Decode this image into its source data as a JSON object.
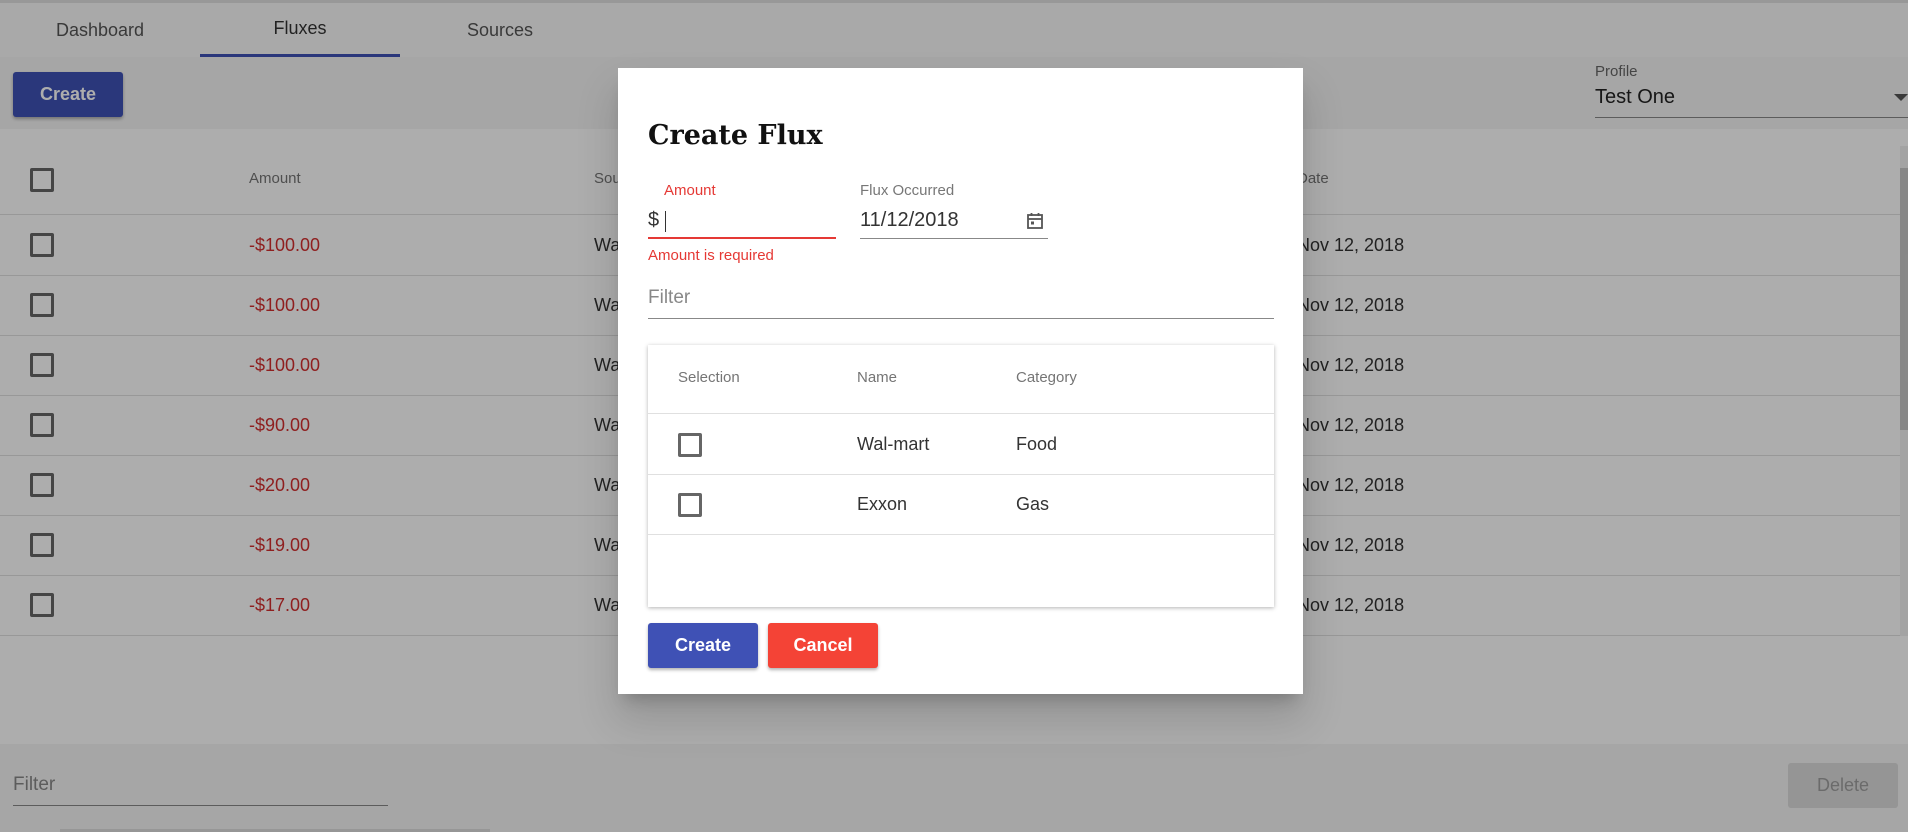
{
  "tabs": [
    {
      "label": "Dashboard",
      "active": false
    },
    {
      "label": "Fluxes",
      "active": true
    },
    {
      "label": "Sources",
      "active": false
    }
  ],
  "toolbar": {
    "create_label": "Create",
    "profile_label": "Profile",
    "profile_value": "Test One"
  },
  "table": {
    "columns": [
      "Amount",
      "Sou",
      "Date"
    ],
    "rows": [
      {
        "amount": "-$100.00",
        "source": "Wa",
        "date": "Nov 12, 2018"
      },
      {
        "amount": "-$100.00",
        "source": "Wa",
        "date": "Nov 12, 2018"
      },
      {
        "amount": "-$100.00",
        "source": "Wa",
        "date": "Nov 12, 2018"
      },
      {
        "amount": "-$90.00",
        "source": "Wa",
        "date": "Nov 12, 2018"
      },
      {
        "amount": "-$20.00",
        "source": "Wa",
        "date": "Nov 12, 2018"
      },
      {
        "amount": "-$19.00",
        "source": "Wa",
        "date": "Nov 12, 2018"
      },
      {
        "amount": "-$17.00",
        "source": "Wa",
        "date": "Nov 12, 2018"
      }
    ]
  },
  "footer": {
    "filter_placeholder": "Filter",
    "delete_label": "Delete"
  },
  "dialog": {
    "title": "Create Flux",
    "amount_label": "Amount",
    "amount_prefix": "$",
    "amount_value": "",
    "amount_error": "Amount is required",
    "date_label": "Flux Occurred",
    "date_value": "11/12/2018",
    "filter_placeholder": "Filter",
    "sources_table": {
      "columns": [
        "Selection",
        "Name",
        "Category"
      ],
      "rows": [
        {
          "name": "Wal-mart",
          "category": "Food",
          "selected": false
        },
        {
          "name": "Exxon",
          "category": "Gas",
          "selected": false
        }
      ]
    },
    "create_label": "Create",
    "cancel_label": "Cancel"
  },
  "colors": {
    "primary": "#3f51b5",
    "danger": "#f44336",
    "error": "#e53935",
    "negative_amount": "#d32f2f"
  }
}
